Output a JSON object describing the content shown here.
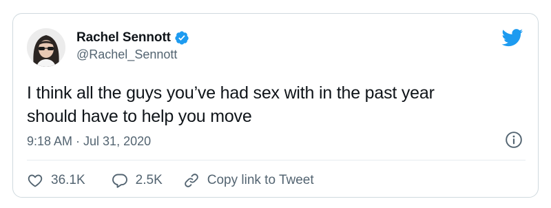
{
  "tweet": {
    "author": {
      "display_name": "Rachel Sennott",
      "handle": "@Rachel_Sennott",
      "verified": true
    },
    "text_line1": "I think all the guys you’ve had sex with in the past year",
    "text_line2": "should have to help you move",
    "timestamp": "9:18 AM · Jul 31, 2020",
    "actions": {
      "likes": "36.1K",
      "replies": "2.5K",
      "copy_link_label": "Copy link to Tweet"
    }
  },
  "colors": {
    "brand_blue": "#1d9bf0",
    "text_primary": "#0f1419",
    "text_secondary": "#536471",
    "border": "#cfd9de"
  },
  "icons": [
    "twitter-bird-icon",
    "verified-badge-icon",
    "info-icon",
    "heart-icon",
    "reply-icon",
    "link-icon"
  ]
}
